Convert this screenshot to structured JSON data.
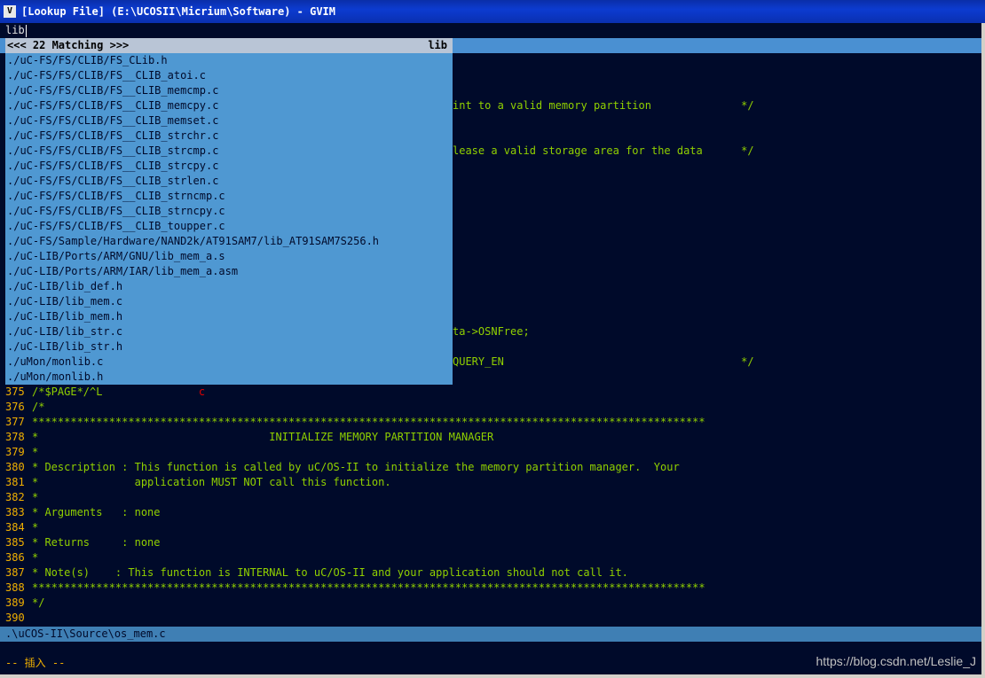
{
  "window": {
    "title": "[Lookup File] (E:\\UCOSII\\Micrium\\Software) - GVIM",
    "icon_glyph": "V"
  },
  "command_input": "lib",
  "lookup": {
    "header_left": "<<< 22 Matching >>>",
    "header_right": "lib",
    "results": [
      "./uC-FS/FS/CLIB/FS_CLib.h",
      "./uC-FS/FS/CLIB/FS__CLIB_atoi.c",
      "./uC-FS/FS/CLIB/FS__CLIB_memcmp.c",
      "./uC-FS/FS/CLIB/FS__CLIB_memcpy.c",
      "./uC-FS/FS/CLIB/FS__CLIB_memset.c",
      "./uC-FS/FS/CLIB/FS__CLIB_strchr.c",
      "./uC-FS/FS/CLIB/FS__CLIB_strcmp.c",
      "./uC-FS/FS/CLIB/FS__CLIB_strcpy.c",
      "./uC-FS/FS/CLIB/FS__CLIB_strlen.c",
      "./uC-FS/FS/CLIB/FS__CLIB_strncmp.c",
      "./uC-FS/FS/CLIB/FS__CLIB_strncpy.c",
      "./uC-FS/FS/CLIB/FS__CLIB_toupper.c",
      "./uC-FS/Sample/Hardware/NAND2k/AT91SAM7/lib_AT91SAM7S256.h",
      "./uC-LIB/Ports/ARM/GNU/lib_mem_a.s",
      "./uC-LIB/Ports/ARM/IAR/lib_mem_a.asm",
      "./uC-LIB/lib_def.h",
      "./uC-LIB/lib_mem.c",
      "./uC-LIB/lib_mem.h",
      "./uC-LIB/lib_str.c",
      "./uC-LIB/lib_str.h",
      "./uMon/monlib.c",
      "./uMon/monlib.h"
    ]
  },
  "background_fragments": [
    {
      "row": 4,
      "text": "int to a valid memory partition              */"
    },
    {
      "row": 7,
      "text": "lease a valid storage area for the data      */"
    },
    {
      "row": 19,
      "text": "ta->OSNFree;"
    },
    {
      "row": 21,
      "text": "QUERY_EN                                     */"
    }
  ],
  "code_lines": [
    {
      "num": "375",
      "text": "/*$PAGE*/^L",
      "mark": "c"
    },
    {
      "num": "376",
      "text": "/*"
    },
    {
      "num": "377",
      "text": "*********************************************************************************************************"
    },
    {
      "num": "378",
      "text": "*                                    INITIALIZE MEMORY PARTITION MANAGER"
    },
    {
      "num": "379",
      "text": "*"
    },
    {
      "num": "380",
      "text": "* Description : This function is called by uC/OS-II to initialize the memory partition manager.  Your"
    },
    {
      "num": "381",
      "text": "*               application MUST NOT call this function."
    },
    {
      "num": "382",
      "text": "*"
    },
    {
      "num": "383",
      "text": "* Arguments   : none"
    },
    {
      "num": "384",
      "text": "*"
    },
    {
      "num": "385",
      "text": "* Returns     : none"
    },
    {
      "num": "386",
      "text": "*"
    },
    {
      "num": "387",
      "text": "* Note(s)    : This function is INTERNAL to uC/OS-II and your application should not call it."
    },
    {
      "num": "388",
      "text": "*********************************************************************************************************"
    },
    {
      "num": "389",
      "text": "*/"
    },
    {
      "num": "390",
      "text": ""
    }
  ],
  "status_line": ".\\uCOS-II\\Source\\os_mem.c",
  "mode_line": "-- 插入 --",
  "watermark": "https://blog.csdn.net/Leslie_J"
}
